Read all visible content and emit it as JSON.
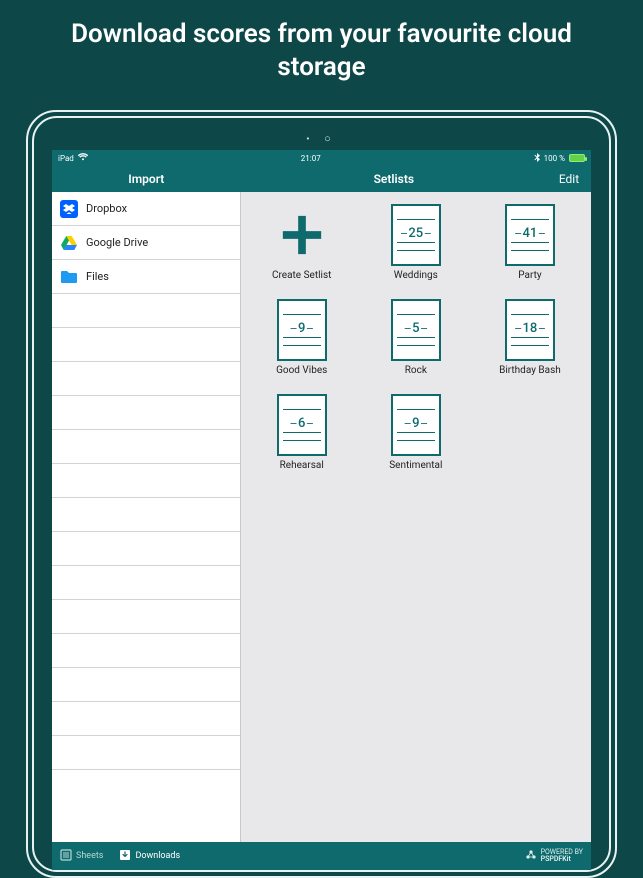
{
  "promo_title": "Download scores from your favourite cloud storage",
  "statusbar": {
    "device": "iPad",
    "time": "21:07",
    "battery_pct": "100 %"
  },
  "navbar": {
    "left_title": "Import",
    "center_title": "Setlists",
    "edit_label": "Edit"
  },
  "import_sources": [
    {
      "label": "Dropbox",
      "icon": "dropbox-icon"
    },
    {
      "label": "Google Drive",
      "icon": "google-drive-icon"
    },
    {
      "label": "Files",
      "icon": "files-icon"
    }
  ],
  "create_label": "Create Setlist",
  "setlists": [
    {
      "label": "Weddings",
      "count": 25
    },
    {
      "label": "Party",
      "count": 41
    },
    {
      "label": "Good Vibes",
      "count": 9
    },
    {
      "label": "Rock",
      "count": 5
    },
    {
      "label": "Birthday Bash",
      "count": 18
    },
    {
      "label": "Rehearsal",
      "count": 6
    },
    {
      "label": "Sentimental",
      "count": 9
    }
  ],
  "tabs": {
    "sheets": "Sheets",
    "downloads": "Downloads"
  },
  "powered_by": {
    "top": "POWERED BY",
    "bottom": "PSPDFKit"
  },
  "colors": {
    "brand": "#0e6a6c",
    "bg": "#0d4748"
  }
}
